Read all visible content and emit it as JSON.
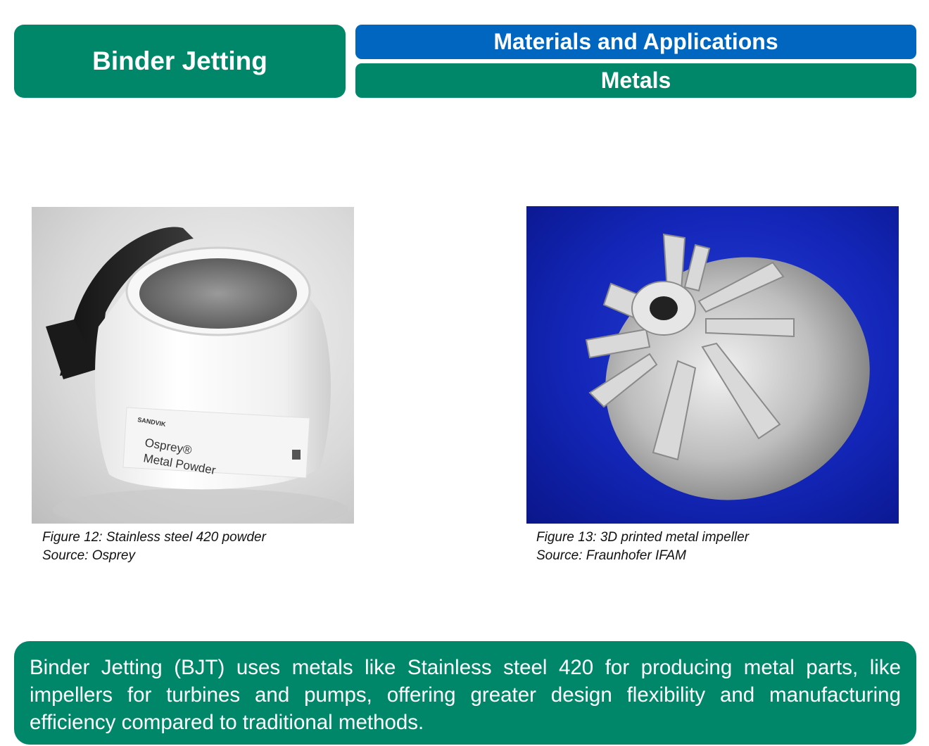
{
  "header": {
    "title": "Binder Jetting",
    "section": "Materials and Applications",
    "subsection": "Metals"
  },
  "figures": [
    {
      "image_label_brand": "SANDVIK",
      "image_label_product_line1": "Osprey®",
      "image_label_product_line2": "Metal Powder",
      "caption": "Figure 12: Stainless steel 420 powder",
      "source": "Source: Osprey"
    },
    {
      "caption": "Figure 13: 3D printed metal impeller",
      "source": "Source: Fraunhofer IFAM"
    }
  ],
  "summary": {
    "text": "Binder Jetting (BJT) uses metals like Stainless steel 420 for producing metal parts, like impellers for turbines and pumps, offering greater design flexibility and manufacturing efficiency compared to traditional methods."
  }
}
